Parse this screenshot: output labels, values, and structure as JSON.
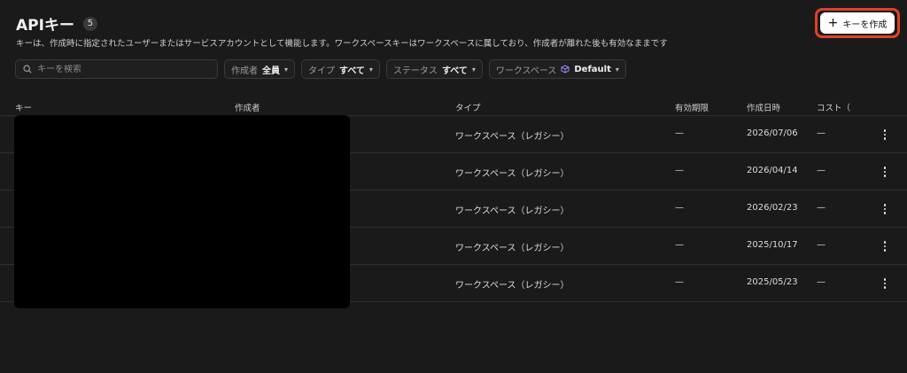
{
  "header": {
    "title": "APIキー",
    "count": "5"
  },
  "description": "キーは、作成時に指定されたユーザーまたはサービスアカウントとして機能します。ワークスペースキーはワークスペースに属しており、作成者が離れた後も有効なままです",
  "create_button": {
    "label": "キーを作成"
  },
  "search": {
    "placeholder": "キーを検索"
  },
  "filters": [
    {
      "label": "作成者",
      "value": "全員"
    },
    {
      "label": "タイプ",
      "value": "すべて"
    },
    {
      "label": "ステータス",
      "value": "すべて"
    },
    {
      "label": "ワークスペース",
      "value": "Default"
    }
  ],
  "table": {
    "columns": [
      "キー",
      "作成者",
      "タイプ",
      "有効期限",
      "作成日時",
      "コスト（"
    ],
    "rows": [
      {
        "type": "ワークスペース（レガシー）",
        "expires": "—",
        "created": "2026/07/06",
        "cost": "—"
      },
      {
        "type": "ワークスペース（レガシー）",
        "expires": "—",
        "created": "2026/04/14",
        "cost": "—"
      },
      {
        "type": "ワークスペース（レガシー）",
        "expires": "—",
        "created": "2026/02/23",
        "cost": "—"
      },
      {
        "type": "ワークスペース（レガシー）",
        "expires": "—",
        "created": "2025/10/17",
        "cost": "—"
      },
      {
        "type": "ワークスペース（レガシー）",
        "expires": "—",
        "created": "2025/05/23",
        "cost": "—"
      }
    ]
  },
  "colors": {
    "accent_outline": "#e0402a",
    "background": "#1a1a1a"
  }
}
